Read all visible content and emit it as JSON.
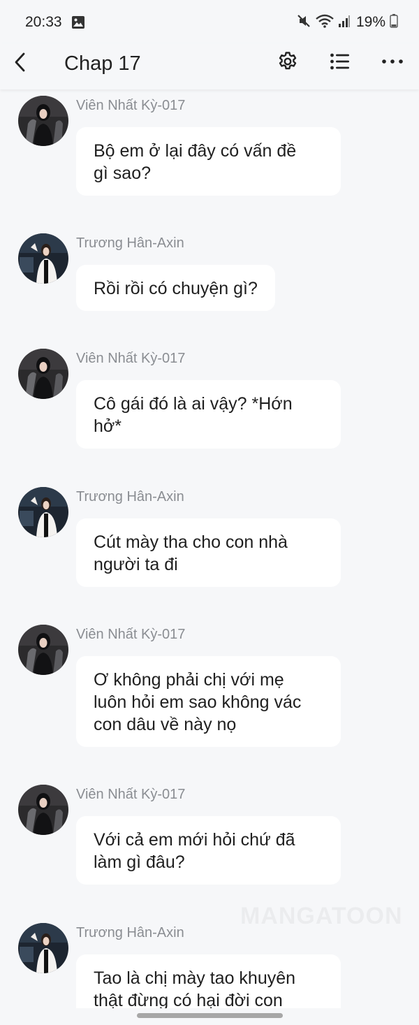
{
  "status_bar": {
    "time": "20:33",
    "battery": "19%",
    "icons": [
      "gallery-icon",
      "mute-icon",
      "wifi-icon",
      "signal-icon",
      "battery-icon"
    ]
  },
  "header": {
    "back_icon": "chevron-left-icon",
    "title": "Chap 17",
    "actions": [
      "gear-icon",
      "list-icon",
      "more-icon"
    ]
  },
  "messages": [
    {
      "sender": "Viên Nhất Kỳ-017",
      "text": "Bộ em ở lại đây có vấn đề\ngì sao?"
    },
    {
      "sender": "Trương Hân-Axin",
      "text": "Rồi rồi có chuyện gì?"
    },
    {
      "sender": "Viên Nhất Kỳ-017",
      "text": "Cô gái đó là ai vậy? *Hớn\nhở*"
    },
    {
      "sender": "Trương Hân-Axin",
      "text": "Cút mày tha cho con nhà\nngười ta đi"
    },
    {
      "sender": "Viên Nhất Kỳ-017",
      "text": "Ơ không phải chị với mẹ\nluôn hỏi em sao không vác\ncon dâu về này nọ"
    },
    {
      "sender": "Viên Nhất Kỳ-017",
      "text": "Với cả em mới hỏi chứ đã\nlàm gì đâu?"
    },
    {
      "sender": "Trương Hân-Axin",
      "text": "Tao là chị mày tao khuyên\nthật đừng có hại đời con"
    }
  ],
  "watermark": "MANGATOON",
  "colors": {
    "background": "#f6f7f9",
    "bubble": "#ffffff",
    "sender_text": "#8a8d92"
  }
}
